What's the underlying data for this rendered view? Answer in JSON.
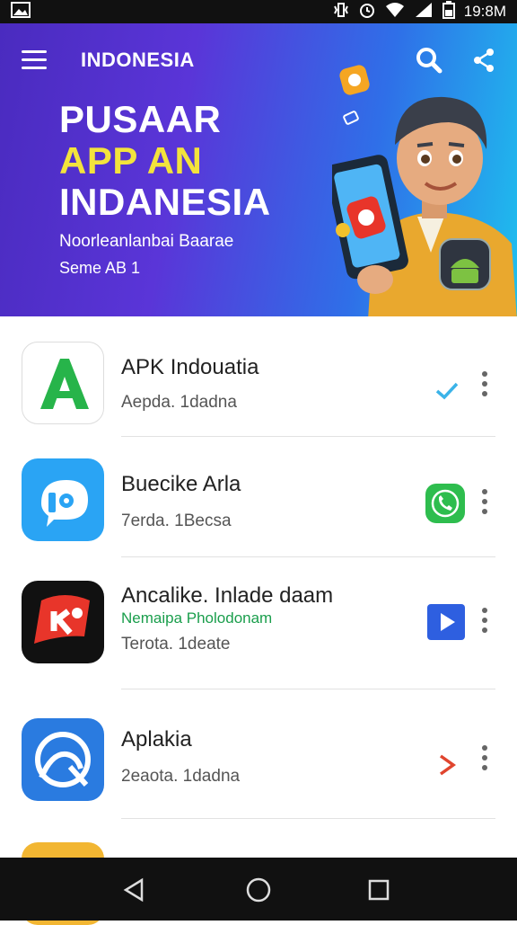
{
  "status_bar": {
    "time": "19:8M"
  },
  "header": {
    "region": "INDONESIA"
  },
  "banner": {
    "line1": "PUSAAR",
    "line2": "APP AN",
    "line3": "INDANESIA",
    "subtitle": "Noorleanlanbai Baarae",
    "version": "Seme AB 1"
  },
  "apps": [
    {
      "title": "APK Indouatia",
      "subtitle": "Aepda. 1dadna",
      "tag": "",
      "action": "check-icon",
      "accent": "#27b44a"
    },
    {
      "title": "Buecike Arla",
      "subtitle": "7erda. 1Becsa",
      "tag": "",
      "action": "phone-icon",
      "accent": "#2aa4f4"
    },
    {
      "title": "Ancalike. Inlade daam",
      "subtitle": "Terota. 1deate",
      "tag": "Nemaipa Pholodonam",
      "action": "play-icon",
      "accent": "#e8352a"
    },
    {
      "title": "Aplakia",
      "subtitle": "2eaota. 1dadna",
      "tag": "",
      "action": "chevron-right-icon",
      "accent": "#2a7be0"
    }
  ],
  "colors": {
    "banner_gradient_start": "#4a2bbf",
    "banner_gradient_end": "#1ec0ee",
    "headline_yellow": "#f3e33c",
    "check_color": "#3bb3e8",
    "phone_color": "#2ebd4e",
    "play_color": "#2e5fe0",
    "chevron_color": "#e0452e"
  }
}
